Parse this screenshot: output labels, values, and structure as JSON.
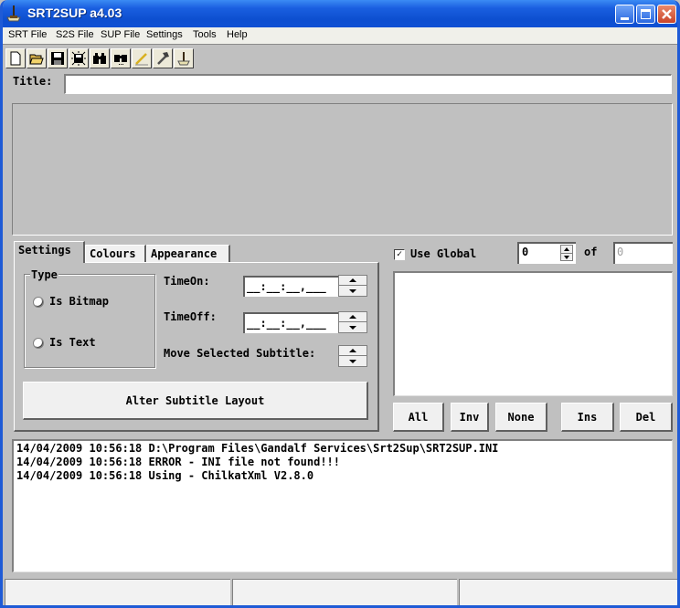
{
  "window": {
    "title": "SRT2SUP a4.03",
    "controls": [
      "minimize",
      "maximize",
      "close"
    ]
  },
  "menubar": {
    "items": [
      {
        "label": "SRT File"
      },
      {
        "label": "S2S File"
      },
      {
        "label": "SUP File"
      },
      {
        "label": "Settings"
      },
      {
        "label": "Tools"
      },
      {
        "label": "Help"
      }
    ]
  },
  "toolbar": {
    "buttons": [
      {
        "icon": "new-document-icon"
      },
      {
        "icon": "open-folder-icon"
      },
      {
        "icon": "save-icon"
      },
      {
        "icon": "save-all-icon"
      },
      {
        "icon": "find-icon"
      },
      {
        "icon": "find-next-icon"
      },
      {
        "icon": "edit-pencil-icon"
      },
      {
        "icon": "hammer-icon"
      },
      {
        "icon": "app-icon"
      }
    ]
  },
  "title_field": {
    "label": "Title:",
    "value": ""
  },
  "tabs": [
    {
      "label": "Settings",
      "active": true
    },
    {
      "label": "Colours",
      "active": false
    },
    {
      "label": "Appearance",
      "active": false
    }
  ],
  "settings": {
    "type_group": {
      "legend": "Type",
      "options": [
        {
          "label": "Is Bitmap",
          "selected": false
        },
        {
          "label": "Is Text",
          "selected": false
        }
      ]
    },
    "time_on": {
      "label": "TimeOn:",
      "value": "__:__:__,___"
    },
    "time_off": {
      "label": "TimeOff:",
      "value": "__:__:__,___"
    },
    "move_selected": {
      "label": "Move Selected Subtitle:"
    },
    "alter_button": "Alter Subtitle Layout"
  },
  "right_panel": {
    "use_global": {
      "label": "Use Global",
      "checked": true,
      "check_glyph": "✓"
    },
    "index_value": "0",
    "of_label": "of",
    "total_value": "0",
    "buttons": [
      {
        "label": "All"
      },
      {
        "label": "Inv"
      },
      {
        "label": "None"
      },
      {
        "label": "Ins"
      },
      {
        "label": "Del"
      }
    ]
  },
  "log": {
    "lines": [
      "14/04/2009 10:56:18 D:\\Program Files\\Gandalf Services\\Srt2Sup\\SRT2SUP.INI",
      "14/04/2009 10:56:18 ERROR - INI file not found!!!",
      "14/04/2009 10:56:18 Using - ChilkatXml V2.8.0"
    ]
  },
  "statusbar": {
    "panels": [
      "",
      "",
      ""
    ]
  },
  "colors": {
    "titlebar": "#0d4fd0",
    "face": "#c0c0c0",
    "button_face": "#f0f0f0"
  }
}
